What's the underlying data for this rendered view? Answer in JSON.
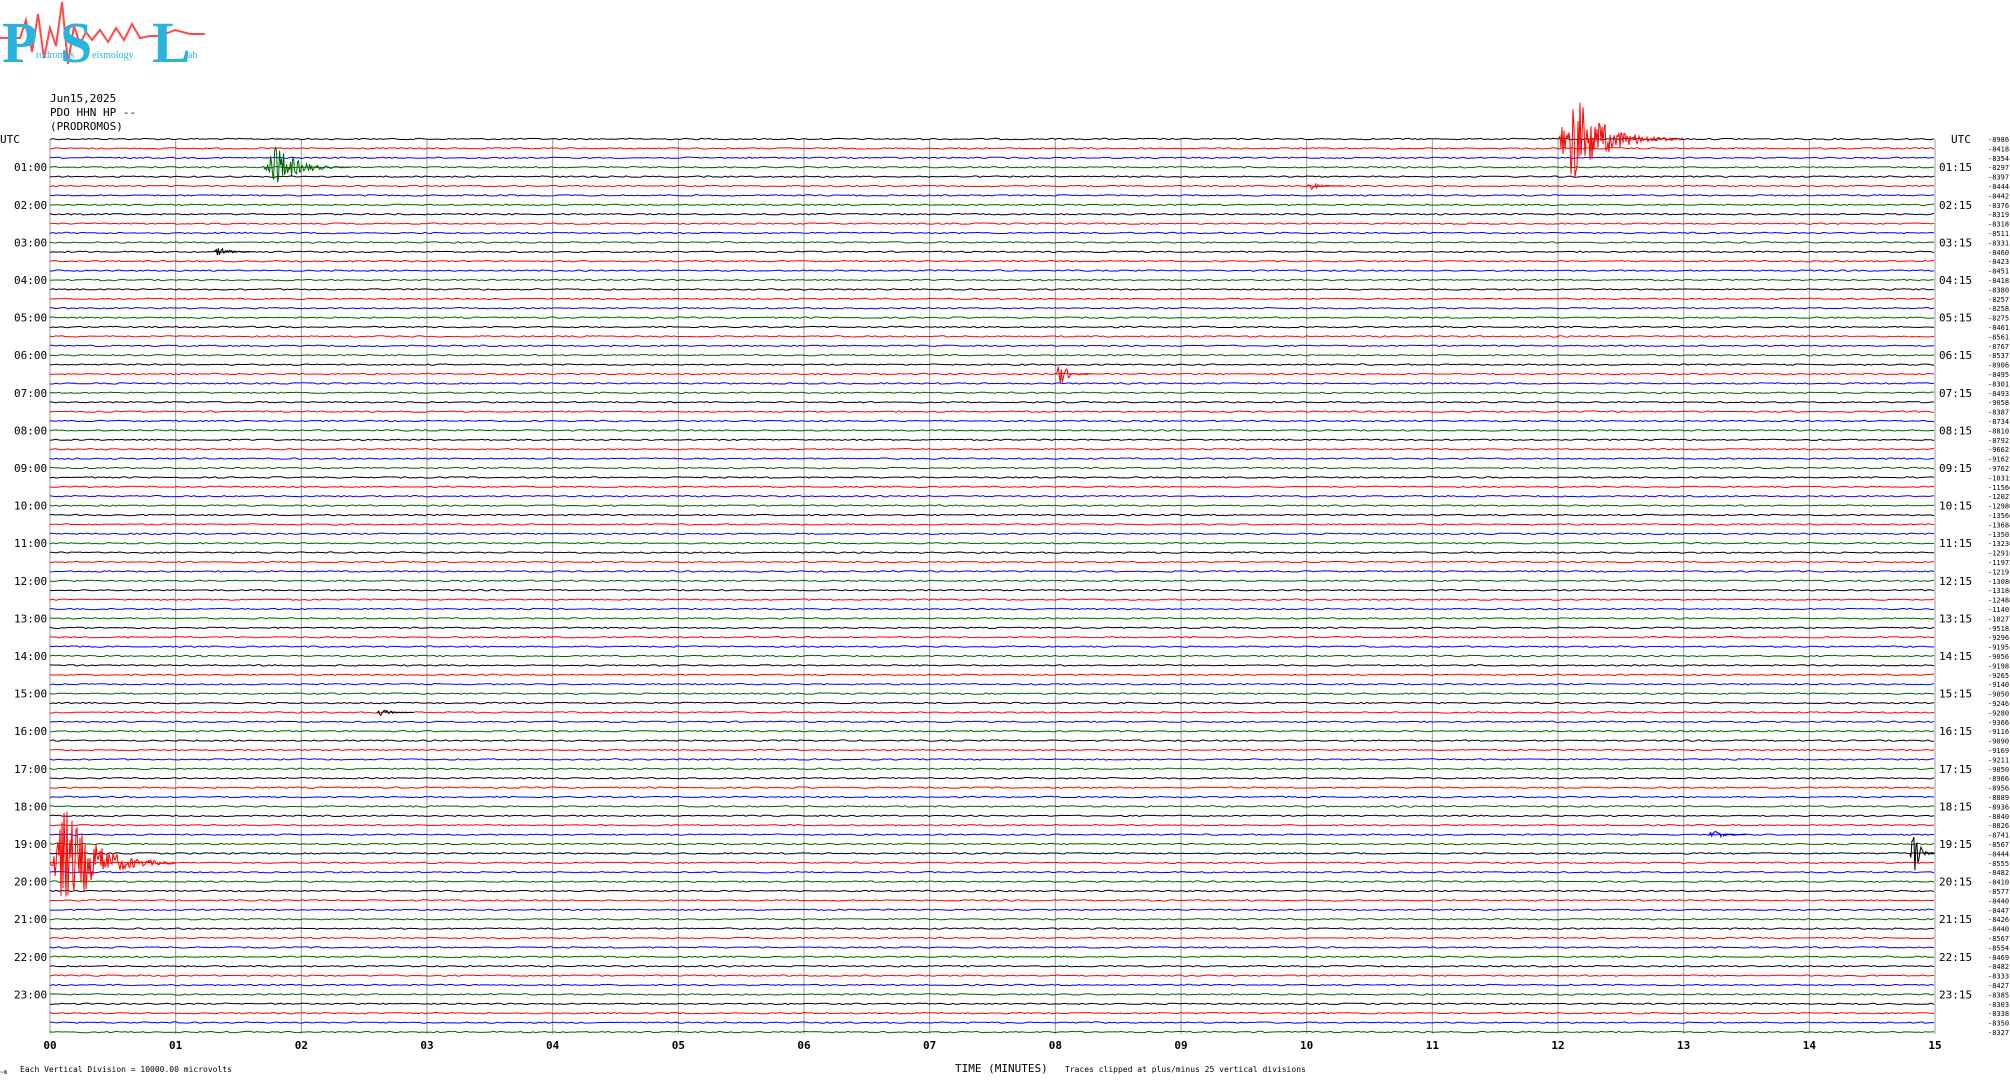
{
  "logo": {
    "letters": [
      "P",
      "S",
      "L"
    ],
    "words": [
      "rodromos",
      "eismology",
      "ab"
    ],
    "brand_color": "#2bb3e0",
    "wave_color": "#ff4a4a"
  },
  "header": {
    "date": "Jun15,2025",
    "station": "PDO HHN HP --",
    "site": "(PRODROMOS)"
  },
  "footer": {
    "scale_note": "Each Vertical Division = 10000.00 microvolts",
    "clip_note": "Traces clipped at plus/minus 25 vertical divisions",
    "corner_mark": "~m"
  },
  "chart_data": {
    "type": "line",
    "title": "",
    "xlabel": "TIME (MINUTES)",
    "xlim": [
      0,
      15
    ],
    "x_ticks": [
      "00",
      "01",
      "02",
      "03",
      "04",
      "05",
      "06",
      "07",
      "08",
      "09",
      "10",
      "11",
      "12",
      "13",
      "14",
      "15"
    ],
    "left_axis_title": "UTC",
    "right_axis_title": "UTC",
    "left_hour_labels": [
      "01:00",
      "02:00",
      "03:00",
      "04:00",
      "05:00",
      "06:00",
      "07:00",
      "08:00",
      "09:00",
      "10:00",
      "11:00",
      "12:00",
      "13:00",
      "14:00",
      "15:00",
      "16:00",
      "17:00",
      "18:00",
      "19:00",
      "20:00",
      "21:00",
      "22:00",
      "23:00"
    ],
    "right_hour_labels": [
      "01:15",
      "02:15",
      "03:15",
      "04:15",
      "05:15",
      "06:15",
      "07:15",
      "08:15",
      "09:15",
      "10:15",
      "11:15",
      "12:15",
      "13:15",
      "14:15",
      "15:15",
      "16:15",
      "17:15",
      "18:15",
      "19:15",
      "20:15",
      "21:15",
      "22:15",
      "23:15"
    ],
    "rows_per_hour": 4,
    "row_colors": [
      "#000000",
      "#ff0000",
      "#0000ff",
      "#006400"
    ],
    "grid": true,
    "grid_color": "#9a9a9a",
    "trace_offsets": [
      -8986,
      -8418,
      -8354,
      -8297,
      -8397,
      -8444,
      -8442,
      -8376,
      -8319,
      -8318,
      -8511,
      -8331,
      -8460,
      -8423,
      -8451,
      -8418,
      -8380,
      -8257,
      -8258,
      -8275,
      -8461,
      -8561,
      -8767,
      -8537,
      -8906,
      -8495,
      -8301,
      -8493,
      -9058,
      -8387,
      -8734,
      -8810,
      -8792,
      -9662,
      -9162,
      -9762,
      -10319,
      -11560,
      -12027,
      -12980,
      -13560,
      -13684,
      -13503,
      -13236,
      -12910,
      -11972,
      -12191,
      -13080,
      -13184,
      -12488,
      -11405,
      -10277,
      -9518,
      -9296,
      -9195,
      -9056,
      -9198,
      -9265,
      -9140,
      -9050,
      -9246,
      -9280,
      -9366,
      -9116,
      -9090,
      -9169,
      -9211,
      -9050,
      -8966,
      -8956,
      -8889,
      -8936,
      -8840,
      -8826,
      -8741,
      -8567,
      -8444,
      -8555,
      -8482,
      -8410,
      -8577,
      -8440,
      -8447,
      -8426,
      -8440,
      -8567,
      -8554,
      -8469,
      -8482,
      -8333,
      -8427,
      -8385,
      -8303,
      -8338,
      -8350,
      -8327
    ],
    "events": [
      {
        "row": 0,
        "start_min": 12.0,
        "duration_min": 1.0,
        "peak_div": 5,
        "color": "#ff0000"
      },
      {
        "row": 3,
        "start_min": 1.7,
        "duration_min": 0.7,
        "peak_div": 2.5,
        "color": "#006400"
      },
      {
        "row": 5,
        "start_min": 10.0,
        "duration_min": 0.3,
        "peak_div": 0.4,
        "color": "#ff0000"
      },
      {
        "row": 12,
        "start_min": 1.3,
        "duration_min": 0.3,
        "peak_div": 0.6,
        "color": "#000000"
      },
      {
        "row": 25,
        "start_min": 8.0,
        "duration_min": 0.3,
        "peak_div": 1.2,
        "color": "#ff0000"
      },
      {
        "row": 61,
        "start_min": 2.6,
        "duration_min": 0.3,
        "peak_div": 0.4,
        "color": "#000000"
      },
      {
        "row": 74,
        "start_min": 13.2,
        "duration_min": 0.3,
        "peak_div": 0.6,
        "color": "#0000ff"
      },
      {
        "row": 76,
        "start_min": 14.8,
        "duration_min": 0.2,
        "peak_div": 3,
        "color": "#000000"
      },
      {
        "row": 77,
        "start_min": 0.0,
        "duration_min": 1.0,
        "peak_div": 6,
        "color": "#ff0000"
      }
    ]
  }
}
